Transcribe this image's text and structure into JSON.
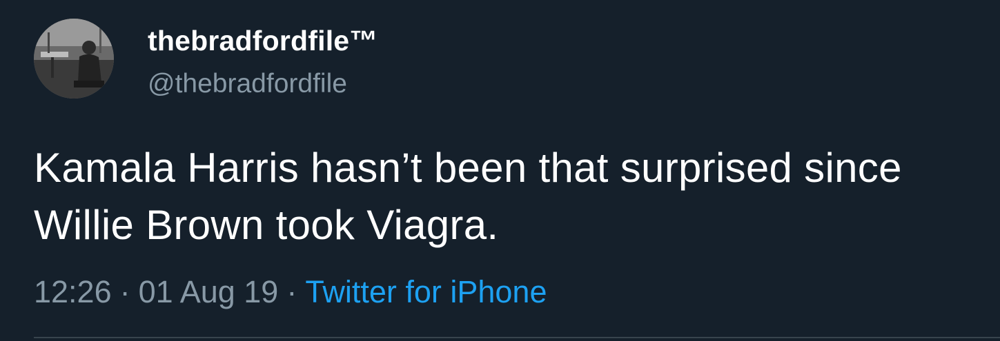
{
  "tweet": {
    "display_name": "thebradfordfile™",
    "handle": "@thebradfordfile",
    "text": "Kamala Harris hasn’t been that surprised since Willie Brown took Viagra.",
    "time": "12:26",
    "date": "01 Aug 19",
    "separator": "·",
    "source": "Twitter for iPhone"
  },
  "colors": {
    "background": "#15202b",
    "primary_text": "#ffffff",
    "secondary_text": "#8899a6",
    "link": "#1da1f2",
    "divider": "#38444d"
  },
  "icons": {
    "avatar": "profile-photo"
  }
}
